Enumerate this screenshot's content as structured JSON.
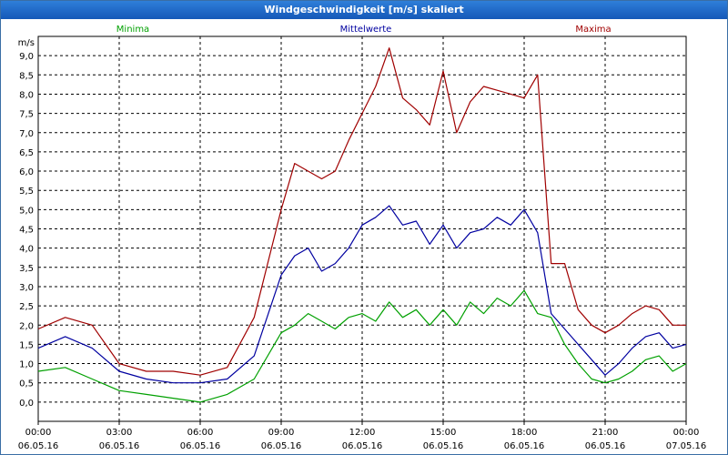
{
  "window": {
    "title": "Windgeschwindigkeit [m/s] skaliert"
  },
  "chart_data": {
    "type": "line",
    "ylabel": "m/s",
    "ylim": [
      -0.5,
      9.5
    ],
    "y_ticks": [
      "0,0",
      "0,5",
      "1,0",
      "1,5",
      "2,0",
      "2,5",
      "3,0",
      "3,5",
      "4,0",
      "4,5",
      "5,0",
      "5,5",
      "6,0",
      "6,5",
      "7,0",
      "7,5",
      "8,0",
      "8,5",
      "9,0"
    ],
    "x_hours": [
      0,
      3,
      6,
      9,
      12,
      15,
      18,
      21,
      24
    ],
    "x_tick_times": [
      "00:00",
      "03:00",
      "06:00",
      "09:00",
      "12:00",
      "15:00",
      "18:00",
      "21:00",
      "00:00"
    ],
    "x_tick_dates": [
      "06.05.16",
      "06.05.16",
      "06.05.16",
      "06.05.16",
      "06.05.16",
      "06.05.16",
      "06.05.16",
      "06.05.16",
      "07.05.16"
    ],
    "grid": true,
    "legend_position": "top",
    "colors": {
      "Minima": "#00a000",
      "Mittelwerte": "#0000a0",
      "Maxima": "#a00000"
    },
    "series": [
      {
        "name": "Minima",
        "x": [
          0,
          1,
          2,
          3,
          4,
          5,
          6,
          7,
          8,
          9,
          9.5,
          10,
          10.5,
          11,
          11.5,
          12,
          12.5,
          13,
          13.5,
          14,
          14.5,
          15,
          15.5,
          16,
          16.5,
          17,
          17.5,
          18,
          18.5,
          19,
          19.5,
          20,
          20.5,
          21,
          21.5,
          22,
          22.5,
          23,
          23.5,
          24
        ],
        "values": [
          0.8,
          0.9,
          0.6,
          0.3,
          0.2,
          0.1,
          0.0,
          0.2,
          0.6,
          1.8,
          2.0,
          2.3,
          2.1,
          1.9,
          2.2,
          2.3,
          2.1,
          2.6,
          2.2,
          2.4,
          2.0,
          2.4,
          2.0,
          2.6,
          2.3,
          2.7,
          2.5,
          2.9,
          2.3,
          2.2,
          1.5,
          1.0,
          0.6,
          0.5,
          0.6,
          0.8,
          1.1,
          1.2,
          0.8,
          1.0
        ]
      },
      {
        "name": "Mittelwerte",
        "x": [
          0,
          1,
          2,
          3,
          4,
          5,
          6,
          7,
          8,
          9,
          9.5,
          10,
          10.5,
          11,
          11.5,
          12,
          12.5,
          13,
          13.5,
          14,
          14.5,
          15,
          15.5,
          16,
          16.5,
          17,
          17.5,
          18,
          18.5,
          19,
          19.5,
          20,
          20.5,
          21,
          21.5,
          22,
          22.5,
          23,
          23.5,
          24
        ],
        "values": [
          1.4,
          1.7,
          1.4,
          0.8,
          0.6,
          0.5,
          0.5,
          0.6,
          1.2,
          3.3,
          3.8,
          4.0,
          3.4,
          3.6,
          4.0,
          4.6,
          4.8,
          5.1,
          4.6,
          4.7,
          4.1,
          4.6,
          4.0,
          4.4,
          4.5,
          4.8,
          4.6,
          5.0,
          4.4,
          2.3,
          1.9,
          1.5,
          1.1,
          0.7,
          1.0,
          1.4,
          1.7,
          1.8,
          1.4,
          1.5
        ]
      },
      {
        "name": "Maxima",
        "x": [
          0,
          1,
          2,
          3,
          4,
          5,
          6,
          7,
          8,
          9,
          9.5,
          10,
          10.5,
          11,
          11.5,
          12,
          12.5,
          13,
          13.5,
          14,
          14.5,
          15,
          15.5,
          16,
          16.5,
          17,
          17.5,
          18,
          18.5,
          19,
          19.5,
          20,
          20.5,
          21,
          21.5,
          22,
          22.5,
          23,
          23.5,
          24
        ],
        "values": [
          1.9,
          2.2,
          2.0,
          1.0,
          0.8,
          0.8,
          0.7,
          0.9,
          2.2,
          5.0,
          6.2,
          6.0,
          5.8,
          6.0,
          6.8,
          7.5,
          8.2,
          9.2,
          7.9,
          7.6,
          7.2,
          8.6,
          7.0,
          7.8,
          8.2,
          8.1,
          8.0,
          7.9,
          8.5,
          3.6,
          3.6,
          2.4,
          2.0,
          1.8,
          2.0,
          2.3,
          2.5,
          2.4,
          2.0,
          2.0
        ]
      }
    ]
  }
}
